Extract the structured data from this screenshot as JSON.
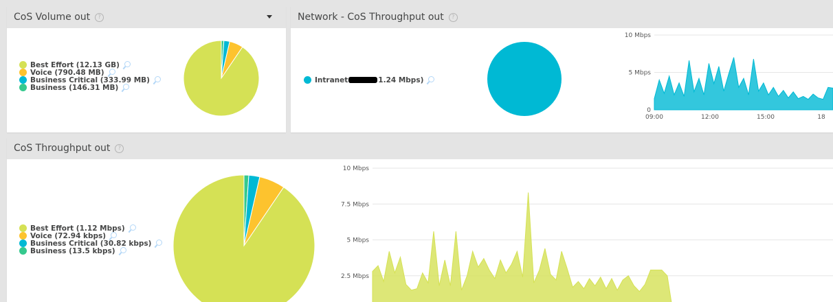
{
  "panels": {
    "volume": {
      "title": "CoS Volume out"
    },
    "network": {
      "title": "Network - CoS Throughput out"
    },
    "throughput": {
      "title": "CoS Throughput out"
    }
  },
  "colors": {
    "best_effort": "#d5e155",
    "voice": "#fdc32e",
    "business_critical": "#00b9d4",
    "business": "#35c98e",
    "intranet": "#00b9d4",
    "header_bg": "#e4e4e4"
  },
  "legends": {
    "volume": [
      {
        "label": "Best Effort (12.13 GB)",
        "color": "#d5e155"
      },
      {
        "label": "Voice (790.48 MB)",
        "color": "#fdc32e"
      },
      {
        "label": "Business Critical (333.99 MB)",
        "color": "#00b9d4"
      },
      {
        "label": "Business (146.31 MB)",
        "color": "#35c98e"
      }
    ],
    "network": {
      "prefix": "Intranet",
      "suffix": "1.24 Mbps)",
      "color": "#00b9d4"
    },
    "throughput": [
      {
        "label": "Best Effort (1.12 Mbps)",
        "color": "#d5e155"
      },
      {
        "label": "Voice (72.94 kbps)",
        "color": "#fdc32e"
      },
      {
        "label": "Business Critical (30.82 kbps)",
        "color": "#00b9d4"
      },
      {
        "label": "Business (13.5 kbps)",
        "color": "#35c98e"
      }
    ]
  },
  "chart_data": [
    {
      "id": "volume-pie",
      "type": "pie",
      "title": "CoS Volume out",
      "categories": [
        "Best Effort",
        "Voice",
        "Business Critical",
        "Business"
      ],
      "values": [
        12130,
        790.48,
        333.99,
        146.31
      ],
      "unit": "MB",
      "colors": [
        "#d5e155",
        "#fdc32e",
        "#00b9d4",
        "#35c98e"
      ]
    },
    {
      "id": "network-pie",
      "type": "pie",
      "title": "Network - CoS Throughput out",
      "categories": [
        "Intranet"
      ],
      "values": [
        1.24
      ],
      "unit": "Mbps",
      "colors": [
        "#00b9d4"
      ]
    },
    {
      "id": "network-area",
      "type": "area",
      "x": [
        "09:00",
        "09:15",
        "09:30",
        "09:45",
        "10:00",
        "10:15",
        "10:30",
        "10:45",
        "11:00",
        "11:15",
        "11:30",
        "11:45",
        "12:00",
        "12:15",
        "12:30",
        "12:45",
        "13:00",
        "13:15",
        "13:30",
        "13:45",
        "14:00",
        "14:15",
        "14:30",
        "14:45",
        "15:00",
        "15:15",
        "15:30",
        "15:45",
        "16:00",
        "16:15",
        "16:30",
        "16:45",
        "17:00",
        "17:15",
        "17:30",
        "17:45",
        "18:00"
      ],
      "xticks": [
        "09:00",
        "12:00",
        "15:00",
        "18"
      ],
      "yticks": [
        "0",
        "5 Mbps",
        "10 Mbps"
      ],
      "ylim": [
        0,
        10
      ],
      "series": [
        {
          "color": "#00b9d4",
          "values": [
            1.5,
            4.0,
            2.2,
            4.5,
            2.0,
            3.6,
            1.8,
            6.6,
            2.4,
            4.2,
            2.0,
            6.2,
            3.5,
            5.8,
            2.5,
            4.8,
            7.0,
            3.0,
            4.2,
            2.0,
            6.8,
            2.5,
            3.6,
            2.0,
            3.0,
            1.8,
            2.6,
            1.6,
            2.4,
            1.5,
            1.8,
            1.4,
            2.1,
            1.6,
            1.4,
            3.0,
            2.9
          ]
        }
      ]
    },
    {
      "id": "throughput-pie",
      "type": "pie",
      "title": "CoS Throughput out",
      "categories": [
        "Best Effort",
        "Voice",
        "Business Critical",
        "Business"
      ],
      "values": [
        1120,
        72.94,
        30.82,
        13.5
      ],
      "unit": "kbps",
      "colors": [
        "#d5e155",
        "#fdc32e",
        "#00b9d4",
        "#35c98e"
      ]
    },
    {
      "id": "throughput-area",
      "type": "area",
      "yticks": [
        "2.5 Mbps",
        "5 Mbps",
        "7.5 Mbps",
        "10 Mbps"
      ],
      "ylim": [
        0,
        10
      ],
      "series": [
        {
          "name": "Best Effort",
          "color": "#d5e155",
          "values": [
            2.8,
            3.2,
            2.1,
            4.2,
            2.7,
            3.8,
            1.9,
            1.5,
            1.6,
            2.7,
            2.0,
            5.6,
            1.8,
            3.6,
            1.8,
            5.6,
            1.5,
            2.5,
            4.2,
            3.1,
            3.7,
            2.9,
            2.3,
            3.6,
            2.7,
            3.3,
            4.2,
            2.4,
            8.3,
            2.0,
            2.9,
            4.4,
            2.6,
            2.2,
            4.2,
            3.0,
            1.7,
            2.1,
            1.6,
            2.3,
            1.8,
            2.4,
            1.6,
            2.3,
            1.5,
            2.2,
            2.5,
            1.8,
            1.4,
            1.9,
            2.9,
            2.9,
            2.9,
            2.5,
            0.0
          ]
        },
        {
          "name": "Voice",
          "color": "#fdc32e",
          "values": [
            0,
            0,
            0,
            0,
            0,
            0,
            0,
            0,
            0,
            0,
            0,
            0,
            0,
            0,
            0,
            0,
            0,
            0,
            0,
            0,
            0,
            0,
            0,
            0,
            0,
            0,
            0,
            0,
            0,
            0,
            0,
            0,
            0,
            0,
            0,
            0,
            0,
            0,
            0,
            0,
            0,
            0,
            0,
            0,
            0,
            0,
            0,
            0,
            0,
            0,
            0,
            0,
            0,
            0,
            0
          ]
        }
      ]
    }
  ]
}
